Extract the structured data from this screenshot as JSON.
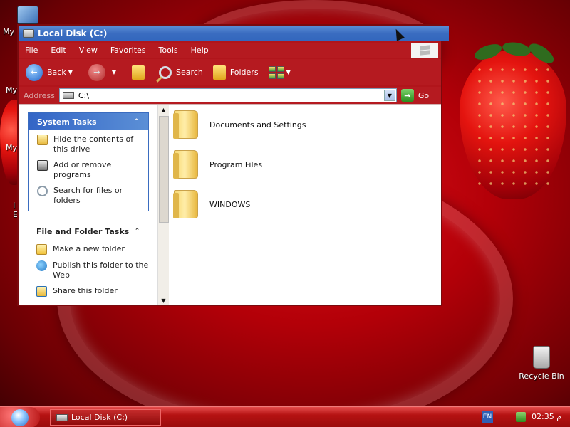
{
  "desktop": {
    "icon_labels": [
      "My I",
      "My",
      "My",
      "I\nE"
    ],
    "recycle_bin_label": "Recycle Bin"
  },
  "window": {
    "title": "Local Disk (C:)",
    "menu": [
      "File",
      "Edit",
      "View",
      "Favorites",
      "Tools",
      "Help"
    ],
    "toolbar": {
      "back_label": "Back",
      "search_label": "Search",
      "folders_label": "Folders"
    },
    "address": {
      "label": "Address",
      "value": "C:\\",
      "go_label": "Go"
    },
    "task_pane": {
      "system_tasks": {
        "title": "System Tasks",
        "items": [
          {
            "label": "Hide the contents of this drive",
            "icon": "folder-icon"
          },
          {
            "label": "Add or remove programs",
            "icon": "add-remove-icon"
          },
          {
            "label": "Search for files or folders",
            "icon": "search-icon"
          }
        ]
      },
      "file_folder_tasks": {
        "title": "File and Folder Tasks",
        "items": [
          {
            "label": "Make a new folder",
            "icon": "new-folder-icon"
          },
          {
            "label": "Publish this folder to the Web",
            "icon": "web-publish-icon"
          },
          {
            "label": "Share this folder",
            "icon": "share-icon"
          }
        ]
      }
    },
    "files": [
      {
        "name": "Documents and Settings"
      },
      {
        "name": "Program Files"
      },
      {
        "name": "WINDOWS"
      }
    ]
  },
  "taskbar": {
    "task_button_label": "Local Disk (C:)",
    "language": "EN",
    "clock": "02:35 م"
  },
  "colors": {
    "accent": "#b51a20",
    "title_blue": "#3a6cc0"
  }
}
